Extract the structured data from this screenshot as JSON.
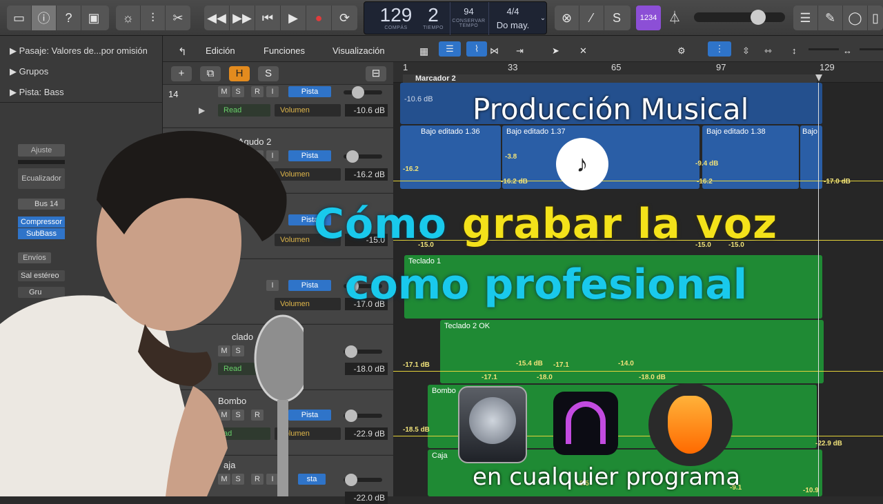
{
  "toolbar": {
    "tempo": "129",
    "tempo_mode": "2",
    "lcd_label_compas": "COMPÁS",
    "lcd_label_tiempo": "TIEMPO",
    "sub_value": "94",
    "sub_label": "CONSERVAR",
    "sub_label2": "TEMPO",
    "signature": "4/4",
    "key": "Do may.",
    "count_in": "1234"
  },
  "inspector": {
    "region_label": "Pasaje:",
    "region_value": "Valores de...por omisión",
    "groups": "Grupos",
    "track_label": "Pista:",
    "track_value": "Bass",
    "setting": "Ajuste",
    "eq": "Ecualizador",
    "bus": "Bus 14",
    "plugin1": "Compressor",
    "plugin2": "SubBass",
    "sends": "Envíos",
    "output": "Sal estéreo",
    "group": "Gru"
  },
  "editbar": {
    "edit": "Edición",
    "functions": "Funciones",
    "view": "Visualización"
  },
  "header_buttons": {
    "h": "H",
    "s": "S"
  },
  "ruler": {
    "marks": [
      "1",
      "33",
      "65",
      "97",
      "129"
    ],
    "marker": "Marcador 2"
  },
  "tracks": [
    {
      "number": "14",
      "name": "",
      "mode": "Read",
      "param": "Volumen",
      "db": "-10.6 dB",
      "pista": "Pista"
    },
    {
      "name": "Bajo Agudo 2",
      "mode": "",
      "param": "Volumen",
      "db": "-16.2 dB",
      "pista": "Pista"
    },
    {
      "name": "",
      "mode": "",
      "param": "Volumen",
      "db": "-15.0",
      "pista": "Pista"
    },
    {
      "name": "",
      "mode": "",
      "param": "Volumen",
      "db": "-17.0 dB",
      "pista": "Pista"
    },
    {
      "name": "clado",
      "mode": "Read",
      "param": "",
      "db": "-18.0 dB",
      "pista": ""
    },
    {
      "name": "Bombo",
      "mode": "ad",
      "param": "Volumen",
      "db": "-22.9 dB",
      "pista": "Pista"
    },
    {
      "name": "aja",
      "mode": "",
      "param": "",
      "db": "-22.0 dB",
      "pista": "sta"
    }
  ],
  "regions": {
    "bass_top_label": "-10.6 dB",
    "bajo1": "Bajo editado 1.36",
    "bajo2": "Bajo editado 1.37",
    "bajo3": "Bajo editado 1.38",
    "bajo4": "Bajo",
    "teclado1": "Teclado 1",
    "teclado2": "Teclado 2 OK",
    "bombo": "Bombo",
    "caja": "Caja"
  },
  "automation": {
    "a1": "-16.2",
    "a2": "-3.8",
    "a3": "-16.2 dB",
    "a4": "-9.4 dB",
    "a5": "-16.2",
    "a6": "-17.0 dB",
    "b1": "-15.0",
    "b2": "-15.0",
    "b3": "-15.0",
    "b4": ".8",
    "c1": "-17.1 dB",
    "c2": "-17.1",
    "c3": "-15.4 dB",
    "c4": "-18.0",
    "c5": "-17.1",
    "c6": "-14.0",
    "c7": "-18.0 dB",
    "d1": "-18.5 dB",
    "d2": "-22.9 dB",
    "e1": "-9.1",
    "e2": "-10.9",
    "e3": "6.5"
  },
  "overlay": {
    "production": "Producción Musical",
    "title_part1": "Cómo ",
    "title_part2": "grabar la voz",
    "title_line2": "como profesional",
    "subtitle": "en cualquier programa"
  },
  "colors": {
    "cyan": "#19c9ec",
    "yellow": "#f4e21a",
    "region_blue": "#2a5ea6",
    "region_green": "#1f8a34"
  }
}
